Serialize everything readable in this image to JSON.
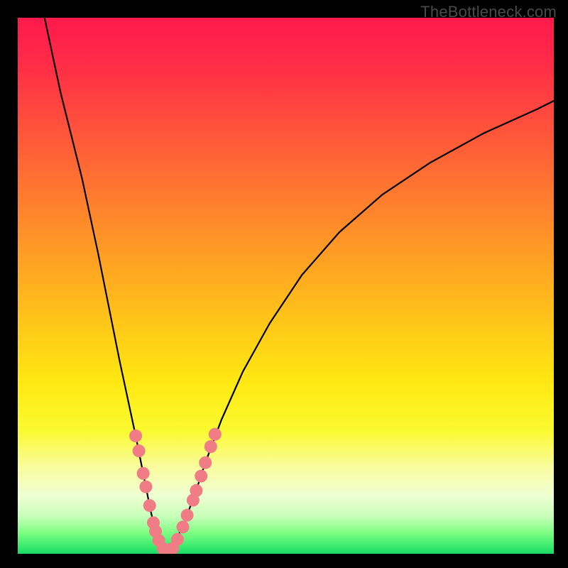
{
  "watermark": "TheBottleneck.com",
  "chart_data": {
    "type": "line",
    "title": "",
    "xlabel": "",
    "ylabel": "",
    "xlim": [
      0,
      100
    ],
    "ylim": [
      0,
      100
    ],
    "series": [
      {
        "name": "curve-left",
        "x": [
          5,
          8,
          12,
          15,
          17,
          19,
          20.5,
          22,
          23,
          24,
          24.8,
          25.5,
          26.2,
          27,
          27.5,
          28
        ],
        "values": [
          100,
          86,
          70,
          56,
          46,
          36,
          29,
          22,
          17,
          12,
          8,
          5,
          3,
          1.5,
          0.5,
          0
        ]
      },
      {
        "name": "curve-right",
        "x": [
          28,
          29,
          30,
          31.5,
          33,
          35,
          38,
          42,
          47,
          53,
          60,
          68,
          77,
          87,
          97,
          100
        ],
        "values": [
          0,
          1.5,
          3.5,
          7,
          11,
          17,
          25,
          34,
          43,
          52,
          60,
          67,
          73,
          78.5,
          83,
          84.5
        ]
      }
    ],
    "beads": {
      "color": "#f07c86",
      "radius": 9,
      "points": [
        {
          "x": 22.0,
          "y": 22.0
        },
        {
          "x": 22.6,
          "y": 19.2
        },
        {
          "x": 23.4,
          "y": 15.0
        },
        {
          "x": 23.9,
          "y": 12.5
        },
        {
          "x": 24.6,
          "y": 9.0
        },
        {
          "x": 25.3,
          "y": 5.8
        },
        {
          "x": 25.7,
          "y": 4.2
        },
        {
          "x": 26.3,
          "y": 2.5
        },
        {
          "x": 27.1,
          "y": 1.0
        },
        {
          "x": 28.0,
          "y": 0.4
        },
        {
          "x": 28.9,
          "y": 1.0
        },
        {
          "x": 29.8,
          "y": 2.7
        },
        {
          "x": 30.8,
          "y": 5.0
        },
        {
          "x": 31.6,
          "y": 7.2
        },
        {
          "x": 32.7,
          "y": 10.0
        },
        {
          "x": 33.3,
          "y": 11.8
        },
        {
          "x": 34.2,
          "y": 14.5
        },
        {
          "x": 35.0,
          "y": 17.0
        },
        {
          "x": 36.0,
          "y": 20.0
        },
        {
          "x": 36.8,
          "y": 22.3
        }
      ]
    }
  }
}
